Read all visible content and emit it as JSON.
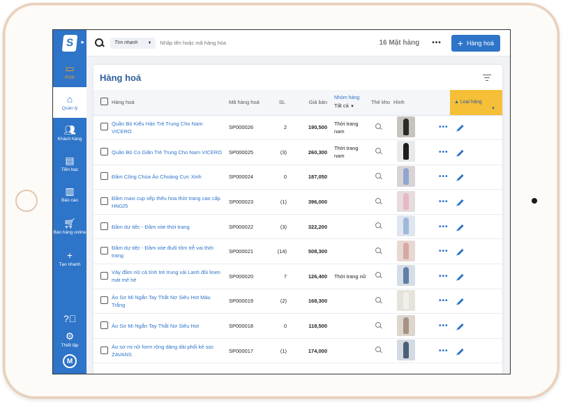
{
  "sidebar": {
    "logo": "S",
    "items": [
      {
        "label": "POS",
        "icon": "monitor-icon"
      },
      {
        "label": "Quản lý",
        "icon": "home-icon"
      },
      {
        "label": "Khách hàng",
        "icon": "users-icon"
      },
      {
        "label": "Tiền bạc",
        "icon": "card-icon"
      },
      {
        "label": "Báo cáo",
        "icon": "chart-icon"
      },
      {
        "label": "Bán hàng online",
        "icon": "cart-icon"
      },
      {
        "label": "Tạo nhanh",
        "icon": "plus-icon"
      }
    ],
    "bottom": [
      {
        "label": "",
        "icon": "help-icon"
      },
      {
        "label": "Thiết lập",
        "icon": "gear-icon"
      }
    ],
    "avatar": "M"
  },
  "topbar": {
    "quick_select": "Tìm nhanh",
    "search_placeholder": "Nhập tên hoặc mã hàng hóa",
    "item_count": "16 Mặt hàng",
    "more": "•••",
    "add_button": "Hàng hoá"
  },
  "panel": {
    "title": "Hàng hoá",
    "columns": {
      "name": "Hàng hoá",
      "code": "Mã hàng hoá",
      "qty": "SL",
      "price": "Giá bán",
      "group_header": "Nhóm hàng",
      "group_select": "Tất cả",
      "stock": "Thẻ kho",
      "image": "Hình",
      "type_header": "Loại hàng"
    },
    "rows": [
      {
        "name": "Quần Bò Kiểu Hàn Trẻ Trung Cho Nam VICERO",
        "code": "SP000026",
        "qty": "2",
        "price": "190,500",
        "group": "Thời trang nam",
        "thumb": "#c9c3bd",
        "fig": "#2b2b2b"
      },
      {
        "name": "Quần Bò Co Giãn Trẻ Trung Cho Nam VICERO",
        "code": "SP000025",
        "qty": "(3)",
        "price": "260,300",
        "group": "Thời trang nam",
        "thumb": "#e9e9e9",
        "fig": "#1d1d1d"
      },
      {
        "name": "Đầm Công Chúa Áo Choàng Cực Xinh",
        "code": "SP000024",
        "qty": "0",
        "price": "187,050",
        "group": "",
        "thumb": "#d9d3d6",
        "fig": "#8fa6d0"
      },
      {
        "name": "Đầm maxi cup xếp thêu hoa thời trang cao cấp HN025",
        "code": "SP000023",
        "qty": "(1)",
        "price": "396,000",
        "group": "",
        "thumb": "#e6dcdc",
        "fig": "#e8b8c4"
      },
      {
        "name": "Đầm dự tiệc - Đầm xòe thời trang",
        "code": "SP000022",
        "qty": "(3)",
        "price": "322,200",
        "group": "",
        "thumb": "#dfe6ef",
        "fig": "#9fb8d8"
      },
      {
        "name": "Đầm dự tiệc - Đầm xòe đuôi tôm trễ vai thời trang",
        "code": "SP000021",
        "qty": "(14)",
        "price": "508,300",
        "group": "",
        "thumb": "#e8d8d4",
        "fig": "#d7a9a3"
      },
      {
        "name": "Váy đầm nữ cá tính trẻ trung vải Lanh đũi linen mát mẻ hè",
        "code": "SP000020",
        "qty": "7",
        "price": "126,400",
        "group": "Thời trang nữ",
        "thumb": "#d5dde6",
        "fig": "#5d7fa8"
      },
      {
        "name": "Áo Sơ Mi Ngắn Tay Thắt Nơ Siêu Hot Màu Trắng",
        "code": "SP000019",
        "qty": "(2)",
        "price": "168,300",
        "group": "",
        "thumb": "#e6e2dc",
        "fig": "#f3f0ea"
      },
      {
        "name": "Áo Sơ Mi Ngắn Tay Thắt Nơ Siêu Hot",
        "code": "SP000018",
        "qty": "0",
        "price": "118,500",
        "group": "",
        "thumb": "#ddd6cf",
        "fig": "#a99282"
      },
      {
        "name": "Áo sơ mi nữ form rộng dáng dài phối kẻ sọc ZAVANS",
        "code": "SP000017",
        "qty": "(1)",
        "price": "174,000",
        "group": "",
        "thumb": "#d4dae2",
        "fig": "#4a5f78"
      }
    ]
  }
}
